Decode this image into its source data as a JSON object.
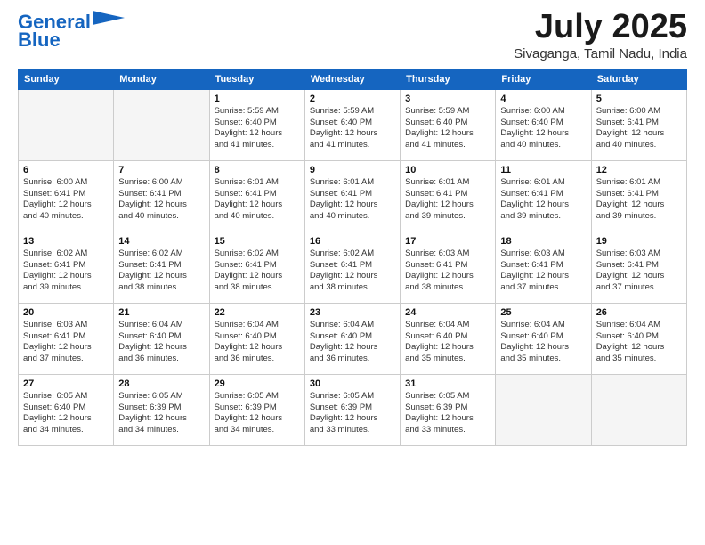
{
  "header": {
    "logo_line1": "General",
    "logo_line2": "Blue",
    "month_title": "July 2025",
    "location": "Sivaganga, Tamil Nadu, India"
  },
  "weekdays": [
    "Sunday",
    "Monday",
    "Tuesday",
    "Wednesday",
    "Thursday",
    "Friday",
    "Saturday"
  ],
  "weeks": [
    [
      {
        "day": "",
        "info": ""
      },
      {
        "day": "",
        "info": ""
      },
      {
        "day": "1",
        "info": "Sunrise: 5:59 AM\nSunset: 6:40 PM\nDaylight: 12 hours\nand 41 minutes."
      },
      {
        "day": "2",
        "info": "Sunrise: 5:59 AM\nSunset: 6:40 PM\nDaylight: 12 hours\nand 41 minutes."
      },
      {
        "day": "3",
        "info": "Sunrise: 5:59 AM\nSunset: 6:40 PM\nDaylight: 12 hours\nand 41 minutes."
      },
      {
        "day": "4",
        "info": "Sunrise: 6:00 AM\nSunset: 6:40 PM\nDaylight: 12 hours\nand 40 minutes."
      },
      {
        "day": "5",
        "info": "Sunrise: 6:00 AM\nSunset: 6:41 PM\nDaylight: 12 hours\nand 40 minutes."
      }
    ],
    [
      {
        "day": "6",
        "info": "Sunrise: 6:00 AM\nSunset: 6:41 PM\nDaylight: 12 hours\nand 40 minutes."
      },
      {
        "day": "7",
        "info": "Sunrise: 6:00 AM\nSunset: 6:41 PM\nDaylight: 12 hours\nand 40 minutes."
      },
      {
        "day": "8",
        "info": "Sunrise: 6:01 AM\nSunset: 6:41 PM\nDaylight: 12 hours\nand 40 minutes."
      },
      {
        "day": "9",
        "info": "Sunrise: 6:01 AM\nSunset: 6:41 PM\nDaylight: 12 hours\nand 40 minutes."
      },
      {
        "day": "10",
        "info": "Sunrise: 6:01 AM\nSunset: 6:41 PM\nDaylight: 12 hours\nand 39 minutes."
      },
      {
        "day": "11",
        "info": "Sunrise: 6:01 AM\nSunset: 6:41 PM\nDaylight: 12 hours\nand 39 minutes."
      },
      {
        "day": "12",
        "info": "Sunrise: 6:01 AM\nSunset: 6:41 PM\nDaylight: 12 hours\nand 39 minutes."
      }
    ],
    [
      {
        "day": "13",
        "info": "Sunrise: 6:02 AM\nSunset: 6:41 PM\nDaylight: 12 hours\nand 39 minutes."
      },
      {
        "day": "14",
        "info": "Sunrise: 6:02 AM\nSunset: 6:41 PM\nDaylight: 12 hours\nand 38 minutes."
      },
      {
        "day": "15",
        "info": "Sunrise: 6:02 AM\nSunset: 6:41 PM\nDaylight: 12 hours\nand 38 minutes."
      },
      {
        "day": "16",
        "info": "Sunrise: 6:02 AM\nSunset: 6:41 PM\nDaylight: 12 hours\nand 38 minutes."
      },
      {
        "day": "17",
        "info": "Sunrise: 6:03 AM\nSunset: 6:41 PM\nDaylight: 12 hours\nand 38 minutes."
      },
      {
        "day": "18",
        "info": "Sunrise: 6:03 AM\nSunset: 6:41 PM\nDaylight: 12 hours\nand 37 minutes."
      },
      {
        "day": "19",
        "info": "Sunrise: 6:03 AM\nSunset: 6:41 PM\nDaylight: 12 hours\nand 37 minutes."
      }
    ],
    [
      {
        "day": "20",
        "info": "Sunrise: 6:03 AM\nSunset: 6:41 PM\nDaylight: 12 hours\nand 37 minutes."
      },
      {
        "day": "21",
        "info": "Sunrise: 6:04 AM\nSunset: 6:40 PM\nDaylight: 12 hours\nand 36 minutes."
      },
      {
        "day": "22",
        "info": "Sunrise: 6:04 AM\nSunset: 6:40 PM\nDaylight: 12 hours\nand 36 minutes."
      },
      {
        "day": "23",
        "info": "Sunrise: 6:04 AM\nSunset: 6:40 PM\nDaylight: 12 hours\nand 36 minutes."
      },
      {
        "day": "24",
        "info": "Sunrise: 6:04 AM\nSunset: 6:40 PM\nDaylight: 12 hours\nand 35 minutes."
      },
      {
        "day": "25",
        "info": "Sunrise: 6:04 AM\nSunset: 6:40 PM\nDaylight: 12 hours\nand 35 minutes."
      },
      {
        "day": "26",
        "info": "Sunrise: 6:04 AM\nSunset: 6:40 PM\nDaylight: 12 hours\nand 35 minutes."
      }
    ],
    [
      {
        "day": "27",
        "info": "Sunrise: 6:05 AM\nSunset: 6:40 PM\nDaylight: 12 hours\nand 34 minutes."
      },
      {
        "day": "28",
        "info": "Sunrise: 6:05 AM\nSunset: 6:39 PM\nDaylight: 12 hours\nand 34 minutes."
      },
      {
        "day": "29",
        "info": "Sunrise: 6:05 AM\nSunset: 6:39 PM\nDaylight: 12 hours\nand 34 minutes."
      },
      {
        "day": "30",
        "info": "Sunrise: 6:05 AM\nSunset: 6:39 PM\nDaylight: 12 hours\nand 33 minutes."
      },
      {
        "day": "31",
        "info": "Sunrise: 6:05 AM\nSunset: 6:39 PM\nDaylight: 12 hours\nand 33 minutes."
      },
      {
        "day": "",
        "info": ""
      },
      {
        "day": "",
        "info": ""
      }
    ]
  ]
}
